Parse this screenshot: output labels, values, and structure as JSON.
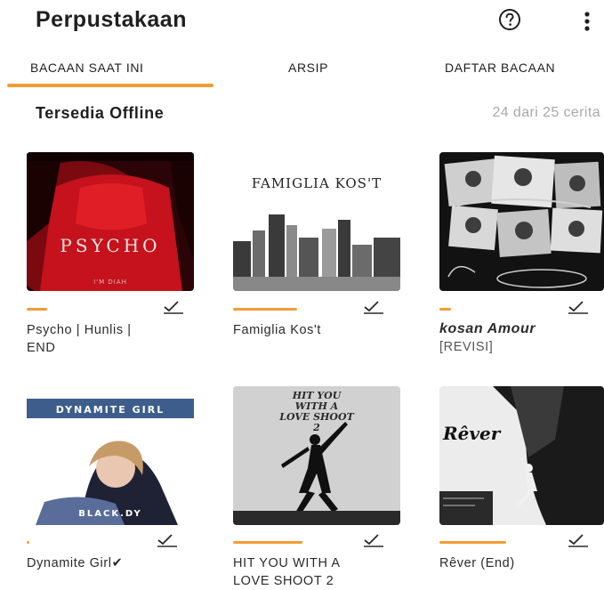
{
  "header": {
    "title": "Perpustakaan",
    "help_icon": "help-circle-icon",
    "more_icon": "more-vertical-icon"
  },
  "tabs": [
    {
      "label": "BACAAN SAAT INI",
      "active": true
    },
    {
      "label": "ARSIP",
      "active": false
    },
    {
      "label": "DAFTAR BACAAN",
      "active": false
    }
  ],
  "section": {
    "title": "Tersedia Offline",
    "count": "24 dari 25 cerita"
  },
  "colors": {
    "accent": "#f39c34",
    "muted": "#a9a9a9",
    "text": "#1f1f1f"
  },
  "books": [
    {
      "title": "Psycho | Hunlis |",
      "subtitle": "END",
      "cover_text": "PSYCHO",
      "cover_author": "I'M DIAH",
      "progress": 0.18,
      "downloaded": true
    },
    {
      "title": "Famiglia Kos't",
      "subtitle": "",
      "cover_text": "FAMIGLIA KOS'T",
      "cover_author": "",
      "progress": 0.55,
      "downloaded": true
    },
    {
      "title": "kosan Amour",
      "subtitle": "[REVISI]",
      "cover_text": "",
      "cover_author": "",
      "progress": 0.1,
      "downloaded": true
    },
    {
      "title": "Dynamite Girl✔",
      "subtitle": "",
      "cover_text": "DYNAMITE GIRL",
      "cover_author": "BLACK.DY",
      "progress": 0.02,
      "downloaded": true
    },
    {
      "title": "HIT YOU WITH A",
      "subtitle": "LOVE SHOOT 2",
      "cover_text": "HIT YOU WITH A LOVE SHOOT 2",
      "cover_author": "",
      "progress": 0.6,
      "downloaded": true
    },
    {
      "title": "Rêver (End)",
      "subtitle": "",
      "cover_text": "Rêver",
      "cover_author": "",
      "progress": 0.58,
      "downloaded": true
    }
  ]
}
